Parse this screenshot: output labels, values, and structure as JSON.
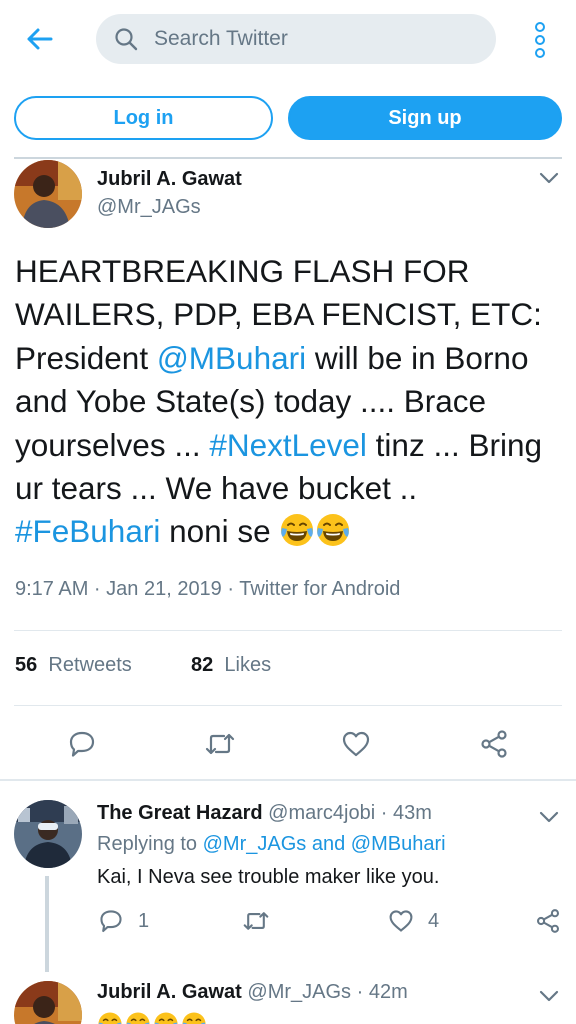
{
  "search": {
    "placeholder": "Search Twitter"
  },
  "auth": {
    "login_label": "Log in",
    "signup_label": "Sign up"
  },
  "main_tweet": {
    "name": "Jubril A. Gawat",
    "handle": "@Mr_JAGs",
    "text_parts": {
      "p1": "HEARTBREAKING FLASH FOR WAILERS, PDP, EBA FENCIST, ETC: President ",
      "mention_buhari": "@MBuhari",
      "p2": " will be in Borno and Yobe State(s) today .... Brace yourselves ... ",
      "hashtag_nextlevel": "#NextLevel",
      "p3": " tinz ... Bring ur tears ... We have bucket .. ",
      "hashtag_febuhari": "#FeBuhari",
      "p4": " noni se "
    },
    "emoji_count": 2,
    "meta": "9:17 AM · Jan 21, 2019 · Twitter for Android",
    "retweets_count": "56",
    "retweets_label": "Retweets",
    "likes_count": "82",
    "likes_label": "Likes"
  },
  "replies": [
    {
      "name": "The Great Hazard",
      "handle": "@marc4jobi",
      "time": "· 43m",
      "replying_prefix": "Replying to ",
      "replying_to_1": "@Mr_JAGs",
      "replying_and": " and ",
      "replying_to_2": "@MBuhari",
      "text": "Kai, I Neva see trouble maker like you.",
      "reply_count": "1",
      "retweet_count": "",
      "like_count": "4"
    },
    {
      "name": "Jubril A. Gawat",
      "handle": "@Mr_JAGs",
      "time": "· 42m",
      "emoji_count": 4
    }
  ],
  "icons": {
    "back": "arrow-left-icon",
    "search": "search-icon",
    "overflow": "vertical-dots-icon",
    "caret": "chevron-down-icon",
    "reply": "speech-bubble-icon",
    "retweet": "retweet-icon",
    "like": "heart-icon",
    "share": "share-icon",
    "emoji": "face-with-tears-of-joy-emoji"
  },
  "colors": {
    "brand": "#1da1f2",
    "link": "#1b95e0",
    "text_primary": "#14171a",
    "text_secondary": "#657786",
    "search_bg": "#e6ecf0",
    "divider": "#e1e8ed"
  }
}
